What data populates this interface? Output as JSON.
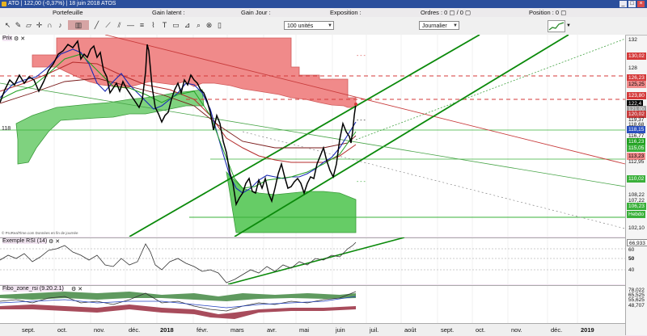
{
  "window": {
    "title": "ATO | 122,00 (-0,37%) | 18 juin 2018 ATOS",
    "minimize_glyph": "_",
    "maximize_glyph": "□",
    "close_glyph": "×"
  },
  "infobar": {
    "portfolio": "Portefeuille",
    "latent_gain": "Gain latent :",
    "day_gain": "Gain Jour :",
    "exposure": "Exposition :",
    "orders": "Ordres : 0 ▢ / 0 ▢",
    "position": "Position : 0 ▢"
  },
  "toolbar": {
    "quantity": "100 unités",
    "period": "Journalier"
  },
  "panels": {
    "price": {
      "label": "Prix",
      "left_level": "118",
      "source_note": "© ProRealTime.com Données en fin de journée"
    },
    "rsi": {
      "label": "Exemple RSI (14)"
    },
    "fibo": {
      "label": "Fibo_zone_rsi (9.20.2.1)"
    }
  },
  "price_axis": {
    "ticks": [
      "132",
      "130,02",
      "128",
      "126,23",
      "125,25",
      "123,80",
      "122,4",
      "121,00",
      "120,02",
      "119,37",
      "118,68",
      "118,15",
      "116,77",
      "116,23",
      "115,05",
      "113,23",
      "112,95",
      "110,02",
      "108,22",
      "107,22",
      "106,23",
      "Hebdo",
      "102,10"
    ],
    "current": "122,4"
  },
  "rsi_axis": {
    "ticks": [
      "66,933",
      "60",
      "50",
      "40"
    ]
  },
  "fibo_axis": {
    "ticks": [
      "78,022",
      "65,525",
      "55,625",
      "48,707"
    ]
  },
  "time_axis": {
    "labels": [
      "sept.",
      "oct.",
      "nov.",
      "déc.",
      "2018",
      "févr.",
      "mars",
      "avr.",
      "mai",
      "juin",
      "juil.",
      "août",
      "sept.",
      "oct.",
      "nov.",
      "déc.",
      "2019"
    ]
  },
  "colors": {
    "title_bg": "#2b4f9c",
    "cloud_red": "#f08a8a",
    "cloud_green": "#66cc66",
    "price_line": "#000000",
    "trend_green": "#0b8a0b",
    "chart_bg": "#ffffff",
    "pane_bg": "#f3e6f3"
  },
  "icons": [
    "cursor-icon",
    "pencil-icon",
    "eraser-icon",
    "crosshair-icon",
    "magnet-icon",
    "bell-icon",
    "envelope-icon",
    "calendar-icon",
    "zoom-icon",
    "trend-line-icon",
    "fibonacci-icon",
    "channel-icon",
    "text-icon",
    "ruler-icon",
    "trash-icon"
  ]
}
